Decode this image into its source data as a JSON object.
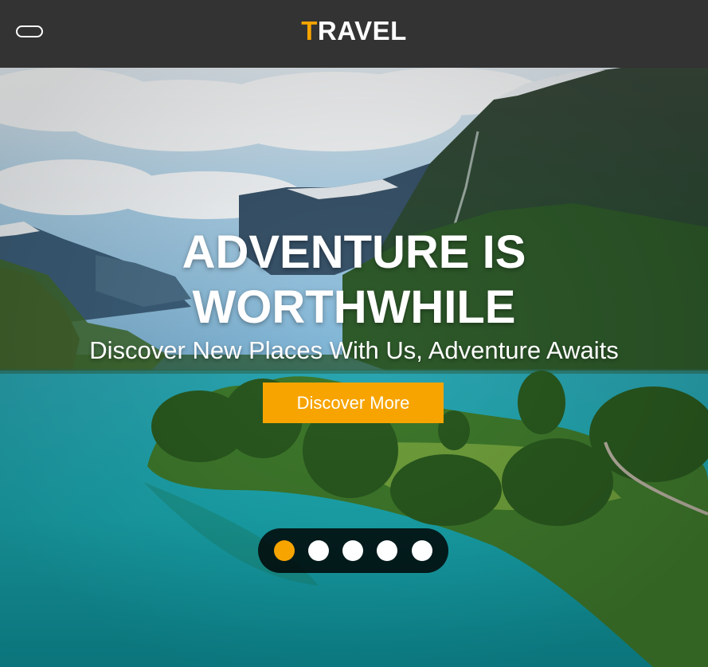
{
  "header": {
    "brand_first_letter": "T",
    "brand_rest": "RAVEL"
  },
  "hero": {
    "headline_line1": "ADVENTURE IS",
    "headline_line2": "WORTHWHILE",
    "subheading": "Discover New Places With Us, Adventure Awaits",
    "cta_label": "Discover More",
    "slides_count": 5,
    "active_slide": 1
  },
  "colors": {
    "accent": "#f7a400",
    "navbar": "#333333",
    "text": "#ffffff",
    "dot_inactive": "#ffffff",
    "dots_bg": "rgba(0,0,0,0.82)"
  },
  "icons": {
    "menu_toggle": "menu-toggle-icon"
  }
}
